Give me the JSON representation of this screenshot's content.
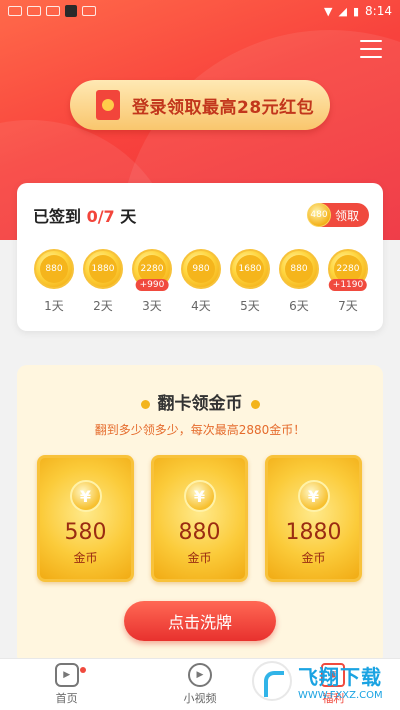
{
  "status_bar": {
    "time": "8:14"
  },
  "login_banner": {
    "text": "登录领取最高28元红包"
  },
  "signin": {
    "title_prefix": "已签到 ",
    "progress": "0/7",
    "title_suffix": " 天",
    "claim_coin": "480",
    "claim_label": "领取",
    "days": [
      {
        "value": "880",
        "label": "1天",
        "bonus": ""
      },
      {
        "value": "1880",
        "label": "2天",
        "bonus": ""
      },
      {
        "value": "2280",
        "label": "3天",
        "bonus": "+990"
      },
      {
        "value": "980",
        "label": "4天",
        "bonus": ""
      },
      {
        "value": "1680",
        "label": "5天",
        "bonus": ""
      },
      {
        "value": "880",
        "label": "6天",
        "bonus": ""
      },
      {
        "value": "2280",
        "label": "7天",
        "bonus": "+1190"
      }
    ]
  },
  "flip": {
    "title": "翻卡领金币",
    "subtitle": "翻到多少领多少，每次最高2880金币！",
    "cards": [
      {
        "amount": "580",
        "unit": "金币"
      },
      {
        "amount": "880",
        "unit": "金币"
      },
      {
        "amount": "1880",
        "unit": "金币"
      }
    ],
    "shuffle_label": "点击洗牌"
  },
  "nav": {
    "items": [
      {
        "label": "首页",
        "icon": "home-icon"
      },
      {
        "label": "小视频",
        "icon": "video-icon"
      },
      {
        "label": "福利",
        "icon": "gift-icon"
      }
    ]
  },
  "watermark": {
    "title": "飞翔下载",
    "url": "WWW.FXXZ.COM"
  },
  "colors": {
    "accent": "#f04a3e",
    "gold": "#f5b51c"
  }
}
